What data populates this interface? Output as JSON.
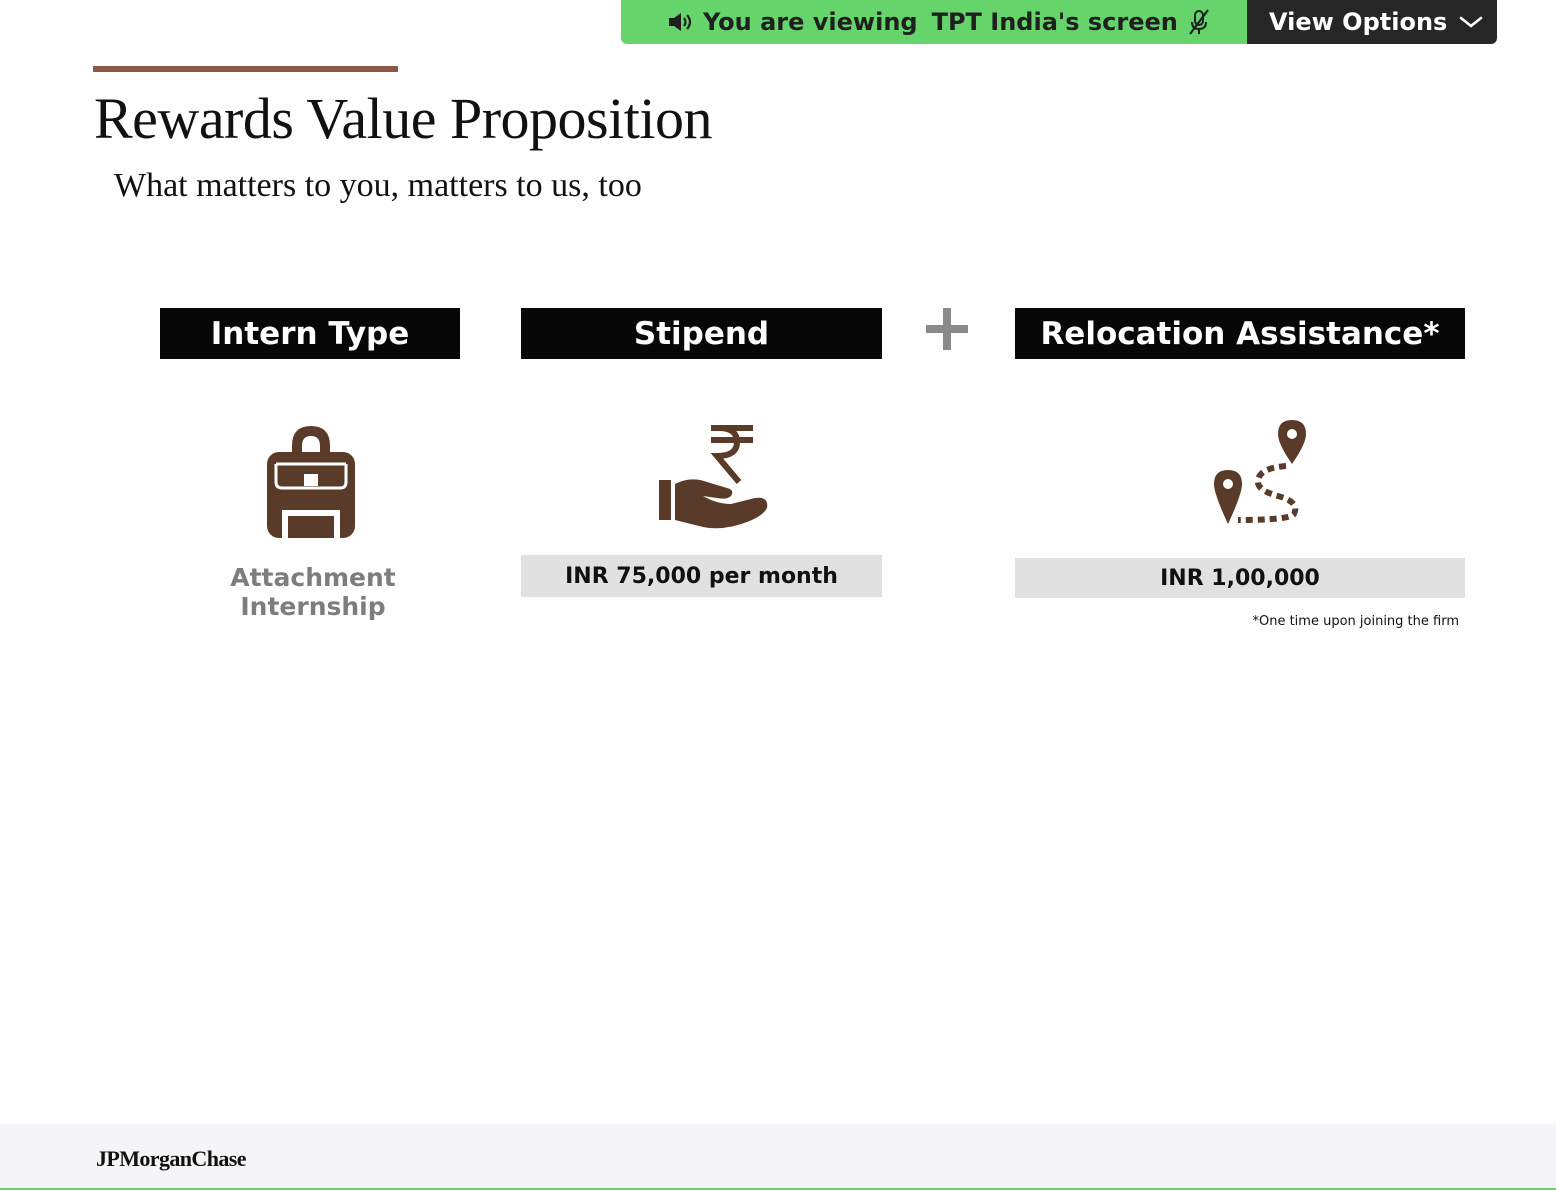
{
  "share_banner": {
    "viewing_text": "You are viewing",
    "presenter_screen": "TPT India's screen",
    "view_options_label": "View Options",
    "colors": {
      "banner": "#65d46a",
      "options": "#262626"
    }
  },
  "slide": {
    "title": "Rewards Value Proposition",
    "subtitle": "What matters to you, matters to us, too",
    "columns": {
      "intern_type": {
        "header": "Intern Type",
        "icon": "backpack-icon",
        "label": "Attachment Internship"
      },
      "stipend": {
        "header": "Stipend",
        "icon": "rupee-hand-icon",
        "value": "INR 75,000 per month"
      },
      "relocation": {
        "header": "Relocation Assistance*",
        "icon": "route-pins-icon",
        "value": "INR 1,00,000",
        "footnote": "*One time upon joining the firm"
      }
    },
    "operator": "plus-icon",
    "accent_color": "#5a3b29",
    "rule_color": "#8a5a44"
  },
  "footer": {
    "logo": "JPMorganChase"
  }
}
